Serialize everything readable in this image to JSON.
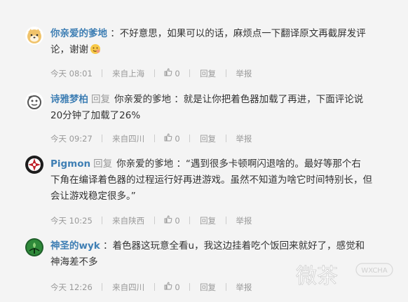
{
  "comments": [
    {
      "user": "你亲爱的爹地",
      "text_line1": "：不好意思，如果可以的话，麻烦点一下翻译原文再截屏发评",
      "text_line2": "论，谢谢",
      "time": "今天 08:01",
      "location": "来自上海",
      "likes": "0",
      "reply_label": "回复",
      "report_label": "举报"
    },
    {
      "user": "诗雅梦柏",
      "reply_kw": "回复",
      "target": "你亲爱的爹地",
      "text_line1": "：就是让你把着色器加载了再进，下面评论说",
      "text_line2": "20分钟了加载了26%",
      "time": "今天 09:27",
      "location": "来自四川",
      "likes": "0",
      "reply_label": "回复",
      "report_label": "举报"
    },
    {
      "user": "Pigmon",
      "reply_kw": "回复",
      "target": "你亲爱的爹地",
      "text_line1": "：“遇到很多卡顿啊闪退啥的。最好等那个右",
      "text_line2": "下角在编译着色器的过程运行好再进游戏。虽然不知道为啥它时间特别长，但",
      "text_line3": "会让游戏稳定很多。”",
      "time": "今天 10:25",
      "location": "来自陕西",
      "likes": "0",
      "reply_label": "回复",
      "report_label": "举报"
    },
    {
      "user": "神圣的wyk",
      "text_line1": "：着色器这玩意全看u，我这边挂着吃个饭回来就好了，感觉和",
      "text_line2": "神海差不多",
      "time": "今天 12:26",
      "location": "来自四川",
      "likes": "0",
      "reply_label": "回复",
      "report_label": "举报"
    }
  ],
  "watermark": {
    "cn": "微茶",
    "en": "WXCHA"
  },
  "colors": {
    "username": "#3f7fb4",
    "meta": "#999999",
    "background": "#f4f4f4"
  }
}
